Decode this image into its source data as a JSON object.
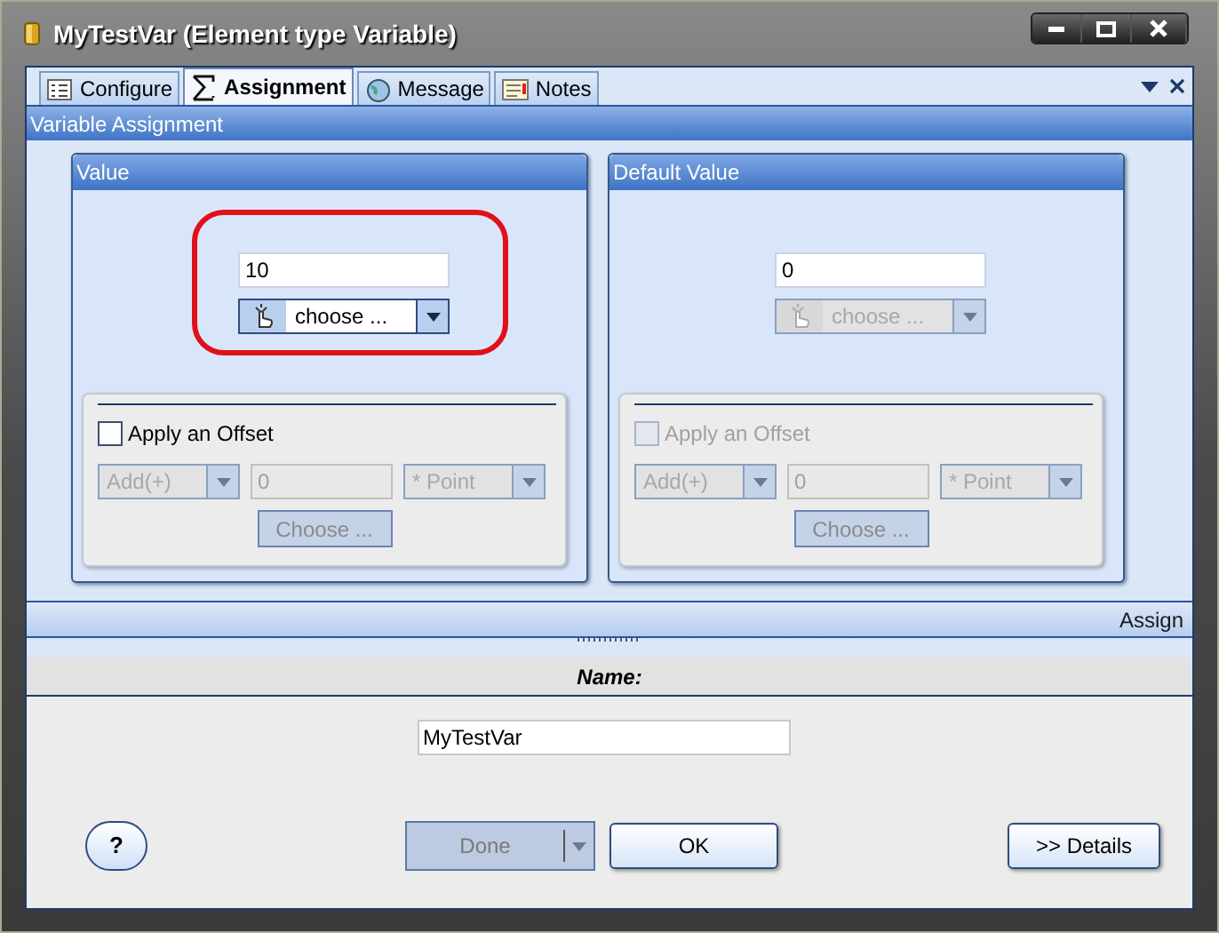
{
  "window": {
    "title": "MyTestVar (Element type Variable)"
  },
  "tabs": [
    {
      "label": "Configure",
      "selected": false
    },
    {
      "label": "Assignment",
      "selected": true
    },
    {
      "label": "Message",
      "selected": false
    },
    {
      "label": "Notes",
      "selected": false
    }
  ],
  "panel": {
    "title": "Variable Assignment",
    "footer": "Assign"
  },
  "groups": [
    {
      "title": "Value",
      "highlighted": true,
      "value": "10",
      "choose": {
        "label": "choose ...",
        "disabled": false
      },
      "offset": {
        "label": "Apply an Offset",
        "checked": false,
        "disabled": false,
        "operator": "Add(+)",
        "amount": "0",
        "unit": "* Point",
        "button": "Choose ...",
        "controls_disabled": true
      }
    },
    {
      "title": "Default Value",
      "highlighted": false,
      "value": "0",
      "choose": {
        "label": "choose ...",
        "disabled": true
      },
      "offset": {
        "label": "Apply an Offset",
        "checked": false,
        "disabled": true,
        "operator": "Add(+)",
        "amount": "0",
        "unit": "* Point",
        "button": "Choose ...",
        "controls_disabled": true
      }
    }
  ],
  "name_section": {
    "title": "Name:",
    "value": "MyTestVar"
  },
  "buttons": {
    "help": "?",
    "done": {
      "label": "Done",
      "disabled": true
    },
    "ok": "OK",
    "details": ">> Details"
  }
}
